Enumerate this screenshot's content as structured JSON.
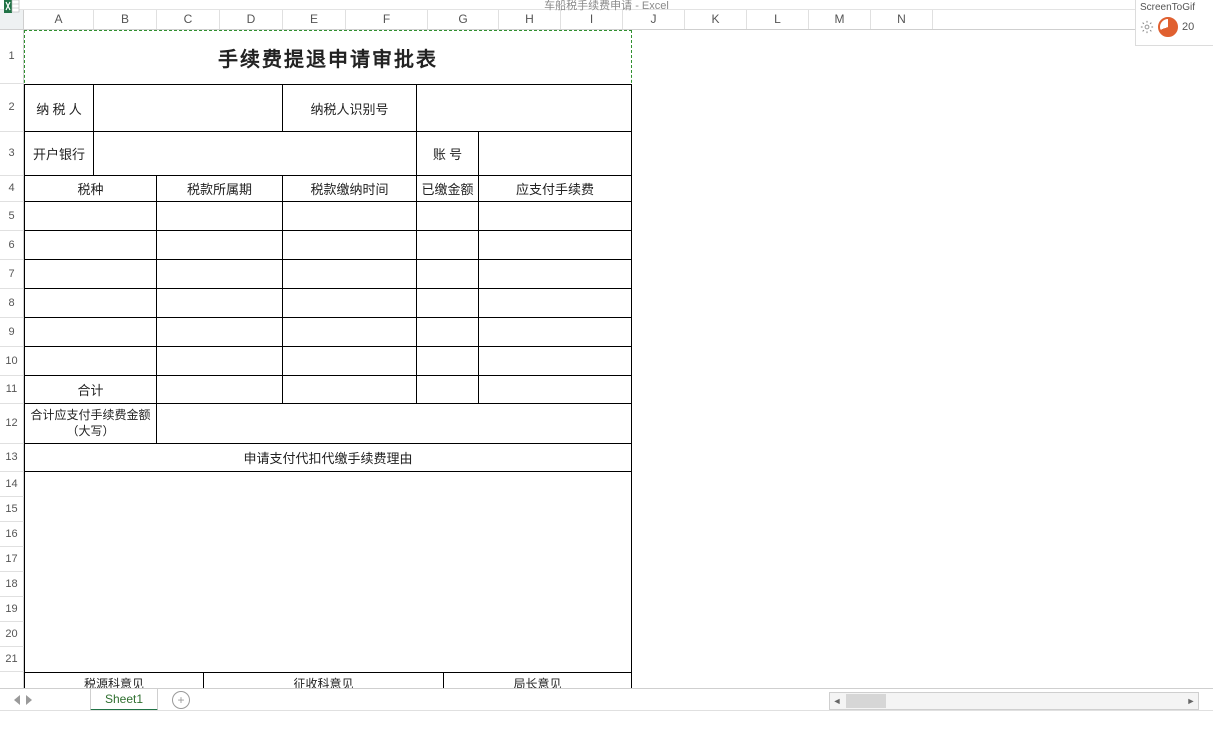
{
  "window": {
    "title": "车船税手续费申请 - Excel"
  },
  "screentogif": {
    "title": "ScreenToGif",
    "num": "20"
  },
  "columns": [
    "A",
    "B",
    "C",
    "D",
    "E",
    "F",
    "G",
    "H",
    "I",
    "J",
    "K",
    "L",
    "M",
    "N"
  ],
  "rows": [
    "1",
    "2",
    "3",
    "4",
    "5",
    "6",
    "7",
    "8",
    "9",
    "10",
    "11",
    "12",
    "13",
    "14",
    "15",
    "16",
    "17",
    "18",
    "19",
    "20",
    "21"
  ],
  "form": {
    "title": "手续费提退申请审批表",
    "r2_taxpayer": "纳 税 人",
    "r2_taxid": "纳税人识别号",
    "r3_bank": "开户银行",
    "r3_account": "账 号",
    "h_taxtype": "税种",
    "h_period": "税款所属期",
    "h_paytime": "税款缴纳时间",
    "h_paid": "已缴金额",
    "h_fee": "应支付手续费",
    "r11_total": "合计",
    "r12_totalcn": "合计应支付手续费金额（大写）",
    "r13_reason": "申请支付代扣代缴手续费理由",
    "foot_src": "税源科意见",
    "foot_levy": "征收科意见",
    "foot_dir": "局长意见"
  },
  "sheet": {
    "name": "Sheet1"
  }
}
